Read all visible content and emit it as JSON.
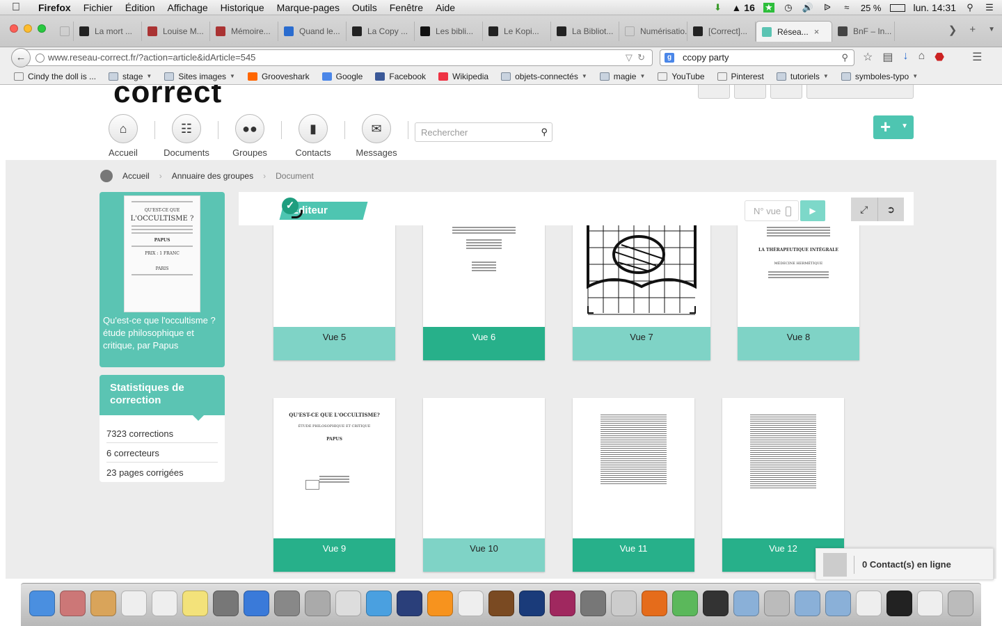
{
  "os_menubar": {
    "app_name": "Firefox",
    "menus": [
      "Fichier",
      "Édition",
      "Affichage",
      "Historique",
      "Marque-pages",
      "Outils",
      "Fenêtre",
      "Aide"
    ],
    "status": {
      "notif_count": "16",
      "battery": "25 %",
      "clock": "lun. 14:31"
    }
  },
  "browser": {
    "tabs": [
      {
        "label": "",
        "favicon": "blank"
      },
      {
        "label": "La mort ...",
        "favicon": "M"
      },
      {
        "label": "Louise M...",
        "favicon": "img"
      },
      {
        "label": "Mémoire...",
        "favicon": "img"
      },
      {
        "label": "Quand le...",
        "favicon": "w"
      },
      {
        "label": "La Copy ...",
        "favicon": "e"
      },
      {
        "label": "Les bibli...",
        "favicon": "B·F"
      },
      {
        "label": "Le Kopi...",
        "favicon": "e"
      },
      {
        "label": "La Bibliot...",
        "favicon": "e"
      },
      {
        "label": "Numérisatio...",
        "favicon": "blank"
      },
      {
        "label": "[Correct]...",
        "favicon": "M"
      },
      {
        "label": "Résea...",
        "favicon": "rc",
        "active": true
      },
      {
        "label": "BnF – In...",
        "favicon": "{"
      }
    ],
    "url": "www.reseau-correct.fr/?action=article&idArticle=545",
    "search_value": "ccopy party",
    "search_engine": "Google",
    "bookmarks": [
      {
        "label": "Cindy the doll is ...",
        "type": "page"
      },
      {
        "label": "stage",
        "type": "folder"
      },
      {
        "label": "Sites images",
        "type": "folder"
      },
      {
        "label": "Grooveshark",
        "type": "page"
      },
      {
        "label": "Google",
        "type": "page"
      },
      {
        "label": "Facebook",
        "type": "page"
      },
      {
        "label": "Wikipedia",
        "type": "page"
      },
      {
        "label": "objets-connectés",
        "type": "folder"
      },
      {
        "label": "magie",
        "type": "folder"
      },
      {
        "label": "YouTube",
        "type": "page"
      },
      {
        "label": "Pinterest",
        "type": "page"
      },
      {
        "label": "tutoriels",
        "type": "folder"
      },
      {
        "label": "symboles-typo",
        "type": "folder"
      }
    ]
  },
  "site": {
    "logo_text": "correct",
    "nav": [
      {
        "label": "Accueil",
        "icon": "home-icon"
      },
      {
        "label": "Documents",
        "icon": "books-icon"
      },
      {
        "label": "Groupes",
        "icon": "group-icon"
      },
      {
        "label": "Contacts",
        "icon": "address-book-icon"
      },
      {
        "label": "Messages",
        "icon": "envelope-icon"
      }
    ],
    "search_placeholder": "Rechercher",
    "breadcrumb": [
      "Accueil",
      "Annuaire des groupes",
      "Document"
    ],
    "accent": "#5bc4b3",
    "accent_dark": "#27b08a"
  },
  "document": {
    "title": "Qu'est-ce que l'occultisme ? étude philosophique et critique, par Papus",
    "thumb_heading": "QU'EST-CE QUE",
    "thumb_big": "L'OCCULTISME ?",
    "thumb_author": "PAPUS",
    "thumb_price": "PRIX : 1 FRANC",
    "thumb_city": "PARIS"
  },
  "stats": {
    "title": "Statistiques de correction",
    "rows": [
      "7323 corrections",
      "6 correcteurs",
      "23 pages corrigées"
    ]
  },
  "editor": {
    "label": "Editeur",
    "vue_placeholder": "N° vue",
    "pages": [
      {
        "label": "Vue 5",
        "state": "light"
      },
      {
        "label": "Vue 6",
        "state": "dark"
      },
      {
        "label": "Vue 7",
        "state": "light"
      },
      {
        "label": "Vue 8",
        "state": "light"
      },
      {
        "label": "Vue 9",
        "state": "dark"
      },
      {
        "label": "Vue 10",
        "state": "light"
      },
      {
        "label": "Vue 11",
        "state": "dark"
      },
      {
        "label": "Vue 12",
        "state": "dark"
      }
    ],
    "page9_title": "QU'EST-CE QUE L'OCCULTISME?",
    "page9_sub": "ÉTUDE PHILOSOPHIQUE ET CRITIQUE",
    "page9_author": "PAPUS",
    "page8_title": "LA THÉRAPEUTIQUE INTÉGRALE",
    "page8_sub": "MÉDECINE HERMÉTIQUE"
  },
  "chat": {
    "label": "0 Contact(s) en ligne"
  }
}
